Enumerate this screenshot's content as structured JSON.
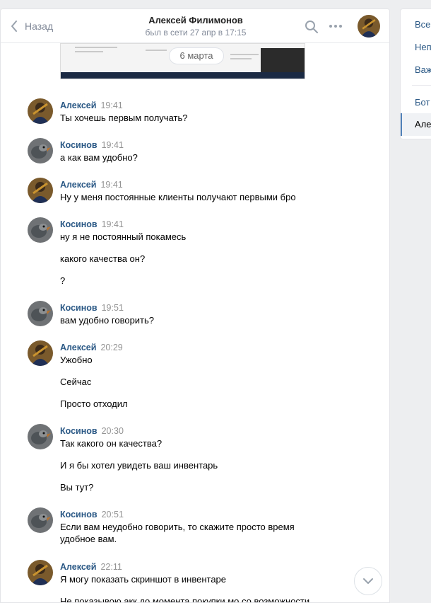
{
  "header": {
    "back_label": "Назад",
    "peer_name": "Алексей Филимонов",
    "peer_status": "был в сети 27 апр в 17:15"
  },
  "history": {
    "date_separator": "6 марта"
  },
  "messages": [
    {
      "author": "Алексей",
      "time": "19:41",
      "avatar": "alexey",
      "lines": [
        "Ты хочешь первым получать?"
      ]
    },
    {
      "author": "Косинов",
      "time": "19:41",
      "avatar": "kosinov",
      "lines": [
        "а как вам удобно?"
      ]
    },
    {
      "author": "Алексей",
      "time": "19:41",
      "avatar": "alexey",
      "lines": [
        "Ну у меня постоянные клиенты получают первыми бро"
      ]
    },
    {
      "author": "Косинов",
      "time": "19:41",
      "avatar": "kosinov",
      "lines": [
        "ну я не постоянный покамесь",
        "какого качества он?",
        "?"
      ]
    },
    {
      "author": "Косинов",
      "time": "19:51",
      "avatar": "kosinov",
      "lines": [
        "вам удобно говорить?"
      ]
    },
    {
      "author": "Алексей",
      "time": "20:29",
      "avatar": "alexey",
      "lines": [
        "Ужобно",
        "Сейчас",
        "Просто отходил"
      ]
    },
    {
      "author": "Косинов",
      "time": "20:30",
      "avatar": "kosinov",
      "lines": [
        "Так какого он качества?",
        "И я бы хотел увидеть ваш инвентарь",
        "Вы тут?"
      ]
    },
    {
      "author": "Косинов",
      "time": "20:51",
      "avatar": "kosinov",
      "lines": [
        "Если вам неудобно говорить, то скажите просто время",
        "удобное вам."
      ]
    },
    {
      "author": "Алексей",
      "time": "22:11",
      "avatar": "alexey",
      "lines": [
        "Я могу показать скриншот в инвентаре",
        "Не показывою акк до момента покупки мо со возможности"
      ]
    }
  ],
  "right_panel": {
    "items": [
      "Все",
      "Неп",
      "Важ",
      "Бот",
      "Але"
    ]
  },
  "icons": {
    "back": "chevron-left-icon",
    "search": "search-icon",
    "more": "more-dots-icon",
    "scroll_down": "chevron-down-icon"
  },
  "colors": {
    "author": "#2a5885",
    "time": "#939393",
    "status": "#828a99",
    "background": "#edeef0"
  }
}
